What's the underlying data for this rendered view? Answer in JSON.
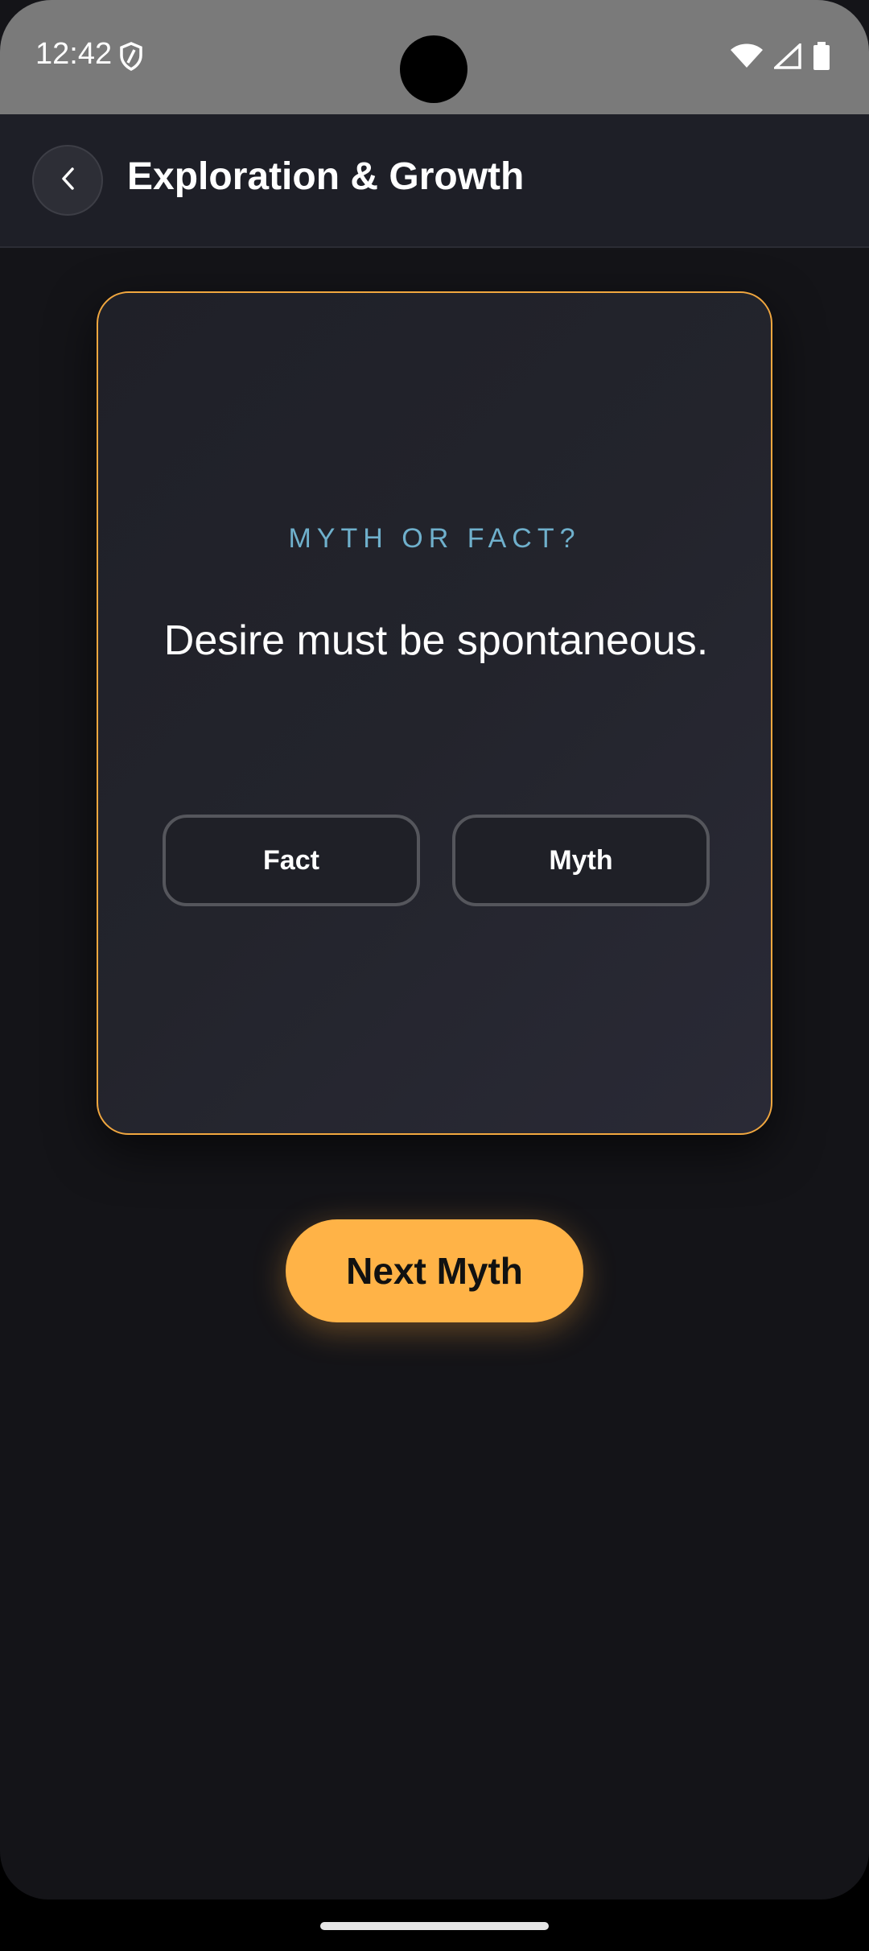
{
  "status_bar": {
    "time": "12:42"
  },
  "header": {
    "title": "Exploration & Growth"
  },
  "card": {
    "kicker": "MYTH OR FACT?",
    "statement": "Desire must be spontaneous.",
    "options": {
      "fact": "Fact",
      "myth": "Myth"
    }
  },
  "actions": {
    "next_label": "Next Myth"
  },
  "colors": {
    "accent": "#ffb347",
    "kicker": "#6fb0cc",
    "background": "#141418"
  }
}
